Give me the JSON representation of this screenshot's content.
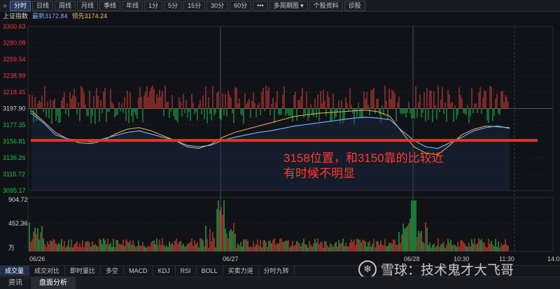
{
  "toolbar": {
    "collapse_icon": "double-chevron-right-icon",
    "tabs": [
      "分时",
      "日线",
      "周线",
      "月线",
      "季线",
      "年线",
      "1分",
      "5分",
      "15分",
      "30分",
      "60分",
      "•••",
      "多周期图",
      "个股资料",
      "诊股"
    ],
    "active_index": 0,
    "dropdown_icon": "chevron-down-icon"
  },
  "info": {
    "index_name": "上证指数",
    "latest_label": "最新3172.84",
    "leading_label": "领先3174.24"
  },
  "price_axis": [
    "3300.63",
    "3280.08",
    "3259.54",
    "3238.99",
    "3218.45",
    "3197.90",
    "3177.35",
    "3156.81",
    "3136.26",
    "3115.72",
    "3095.17"
  ],
  "volume_axis": [
    "904.72",
    "452.36",
    "万"
  ],
  "time_axis": [
    "06/26",
    "06/27",
    "06/28",
    "10:30",
    "11:30",
    "14:0"
  ],
  "annotation": {
    "line1": "3158位置，和3150靠的比较近",
    "line2": "有时候不明显"
  },
  "indicator_tabs": [
    "成交量",
    "成交对比",
    "即时量比",
    "多空",
    "MACD",
    "KDJ",
    "RSI",
    "BOLL",
    "买卖力道",
    "分时九转"
  ],
  "indicator_active": 0,
  "footer_tabs": [
    "资讯",
    "盘面分析"
  ],
  "footer_active": 1,
  "watermark": {
    "text": "雪球：技术鬼才大飞哥",
    "logo_icon": "xueqiu-logo-icon"
  },
  "colors": {
    "up": "#e0403a",
    "down": "#20c04a",
    "price_line": "#6aaeff",
    "avg_line": "#f0b060",
    "annotation": "#ff2a22"
  },
  "chart_data": {
    "type": "line",
    "title": "上证指数",
    "y_range": [
      3095.17,
      3300.63
    ],
    "reference": 3197.9,
    "annotated_level": 3158,
    "sessions": [
      "06/26",
      "06/27",
      "06/28"
    ],
    "series": [
      {
        "name": "最新",
        "values": [
          3192,
          3180,
          3165,
          3160,
          3158,
          3156,
          3160,
          3164,
          3168,
          3170,
          3166,
          3162,
          3158,
          3152,
          3150,
          3152,
          3158,
          3162,
          3165,
          3168,
          3170,
          3173,
          3176,
          3178,
          3180,
          3182,
          3184,
          3186,
          3187,
          3186,
          3184,
          3170,
          3158,
          3150,
          3148,
          3155,
          3162,
          3170,
          3174,
          3176,
          3173
        ]
      },
      {
        "name": "领先",
        "values": [
          3195,
          3182,
          3168,
          3160,
          3155,
          3154,
          3158,
          3166,
          3172,
          3174,
          3170,
          3164,
          3158,
          3150,
          3148,
          3153,
          3162,
          3168,
          3172,
          3176,
          3180,
          3184,
          3188,
          3190,
          3192,
          3193,
          3194,
          3195,
          3196,
          3194,
          3188,
          3168,
          3150,
          3142,
          3140,
          3152,
          3165,
          3172,
          3176,
          3175,
          3174
        ]
      }
    ],
    "volume_range": [
      0,
      904.72
    ]
  }
}
